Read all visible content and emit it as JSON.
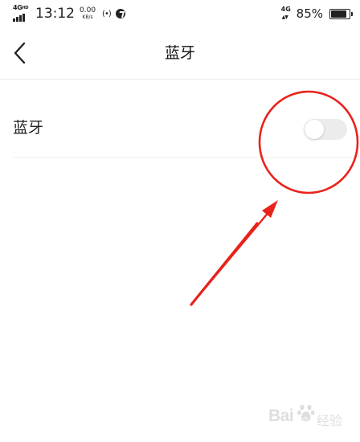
{
  "status_bar": {
    "network_left": "4G",
    "network_left_sup": "HD",
    "time": "13:12",
    "speed_value": "0.00",
    "speed_unit": "KB/s",
    "network_right": "4G",
    "network_right_arrows": "▲▼",
    "battery_text": "85%",
    "battery_level": 0.85
  },
  "header": {
    "title": "蓝牙"
  },
  "settings": {
    "bluetooth": {
      "label": "蓝牙",
      "enabled": false
    }
  },
  "watermark": {
    "brand": "Bai",
    "brand_end": "du",
    "sub": "经验"
  },
  "colors": {
    "annotation": "#e8231c",
    "toggle_off_track": "#ececec",
    "divider": "#ececec"
  }
}
